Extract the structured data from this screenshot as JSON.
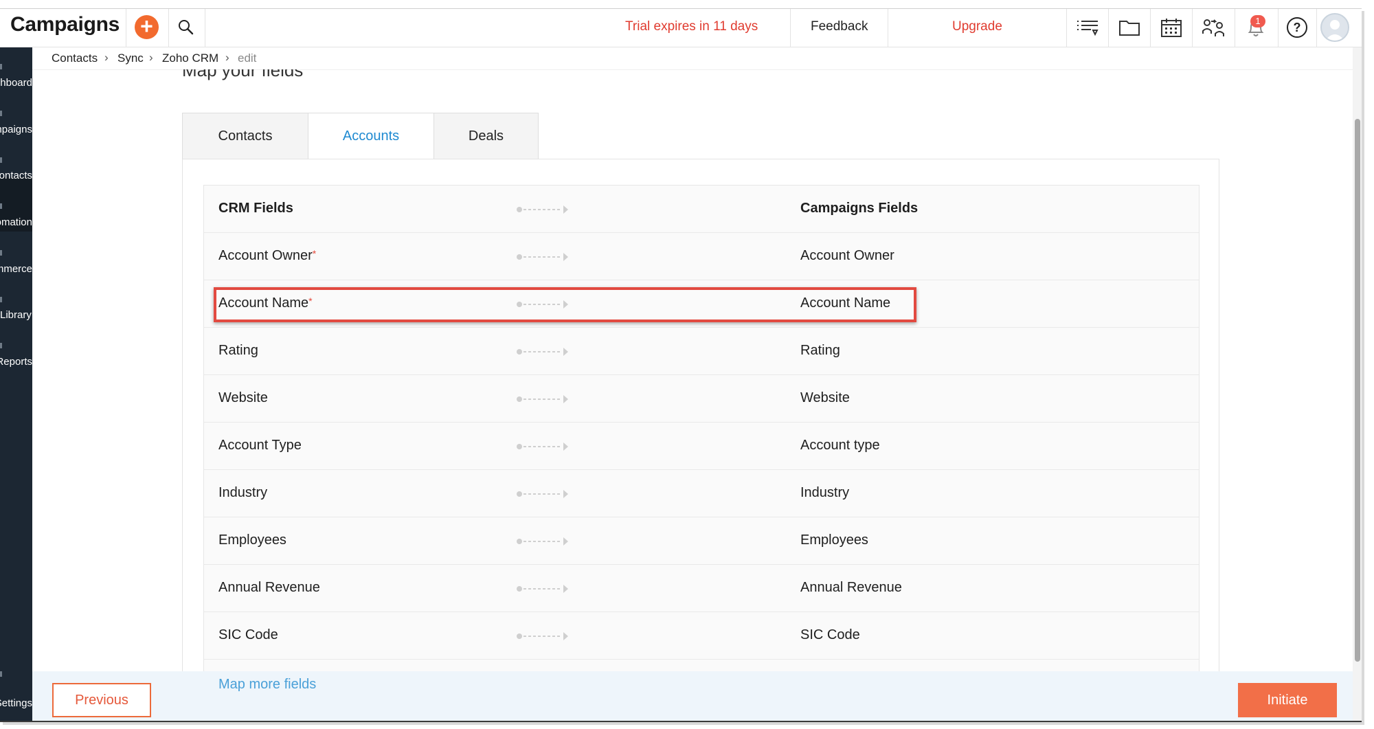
{
  "app": {
    "title": "Campaigns"
  },
  "topbar": {
    "add_icon": "plus-icon",
    "trial": "Trial expires in 11 days",
    "feedback": "Feedback",
    "upgrade": "Upgrade",
    "notification_count": "1",
    "accent_color": "#f26a2e",
    "alert_color": "#e03b2f"
  },
  "sidenav": {
    "items": [
      {
        "label": "Dashboard"
      },
      {
        "label": "Campaigns"
      },
      {
        "label": "Contacts"
      },
      {
        "label": "Automation"
      },
      {
        "label": "E-commerce"
      },
      {
        "label": "Library"
      },
      {
        "label": "Reports"
      },
      {
        "label": "Settings"
      }
    ]
  },
  "breadcrumb": [
    "Contacts",
    "Sync",
    "Zoho CRM",
    "edit"
  ],
  "heading": "Map your fields",
  "tabs": [
    {
      "label": "Contacts",
      "active": false
    },
    {
      "label": "Accounts",
      "active": true
    },
    {
      "label": "Deals",
      "active": false
    }
  ],
  "table": {
    "header": {
      "crm": "CRM Fields",
      "campaigns": "Campaigns Fields"
    },
    "rows": [
      {
        "crm": "Account Owner",
        "required": "*",
        "campaigns": "Account Owner"
      },
      {
        "crm": "Account Name",
        "required": "*",
        "campaigns": "Account Name"
      },
      {
        "crm": "Rating",
        "required": "",
        "campaigns": "Rating"
      },
      {
        "crm": "Website",
        "required": "",
        "campaigns": "Website"
      },
      {
        "crm": "Account Type",
        "required": "",
        "campaigns": "Account type"
      },
      {
        "crm": "Industry",
        "required": "",
        "campaigns": "Industry"
      },
      {
        "crm": "Employees",
        "required": "",
        "campaigns": "Employees"
      },
      {
        "crm": "Annual Revenue",
        "required": "",
        "campaigns": "Annual Revenue"
      },
      {
        "crm": "SIC Code",
        "required": "",
        "campaigns": "SIC Code"
      }
    ]
  },
  "footer": {
    "map_more": "Map more fields",
    "previous": "Previous",
    "initiate": "Initiate"
  }
}
